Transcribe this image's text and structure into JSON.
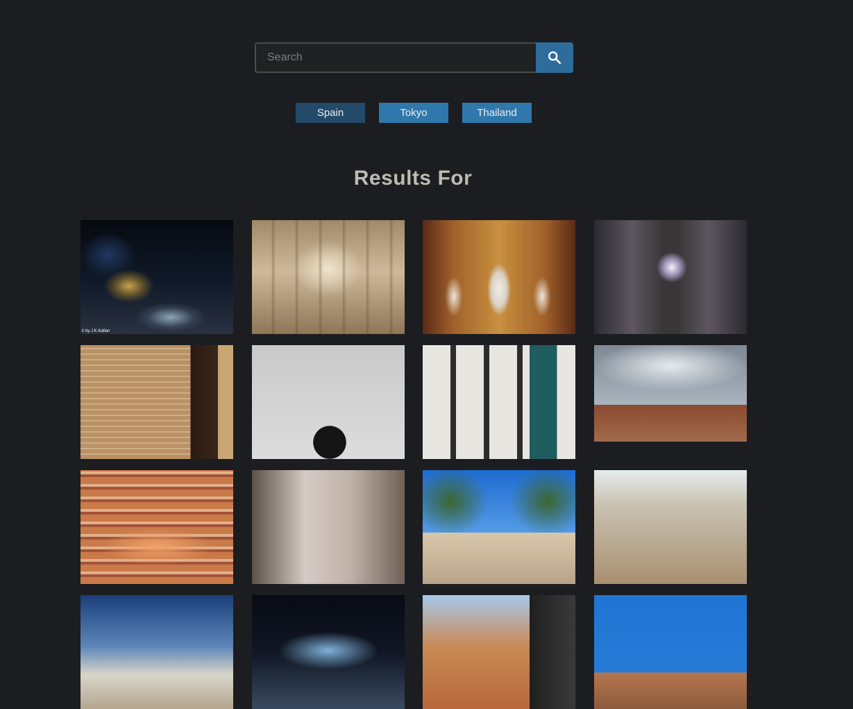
{
  "search": {
    "placeholder": "Search",
    "button_icon": "search-icon"
  },
  "tags": [
    {
      "label": "Spain",
      "active": true,
      "color": "#244a6a"
    },
    {
      "label": "Tokyo",
      "active": false,
      "color": "#3078ab"
    },
    {
      "label": "Thailand",
      "active": false,
      "color": "#3078ab"
    }
  ],
  "results": {
    "title": "Results For"
  },
  "gallery": {
    "images": [
      {
        "credit": "ir by J.K.Kafian"
      },
      {},
      {},
      {},
      {},
      {},
      {},
      {},
      {},
      {},
      {},
      {},
      {},
      {},
      {},
      {}
    ]
  },
  "colors": {
    "background": "#1c1d20",
    "accent": "#2e6d9b",
    "title": "#bfbab4"
  }
}
